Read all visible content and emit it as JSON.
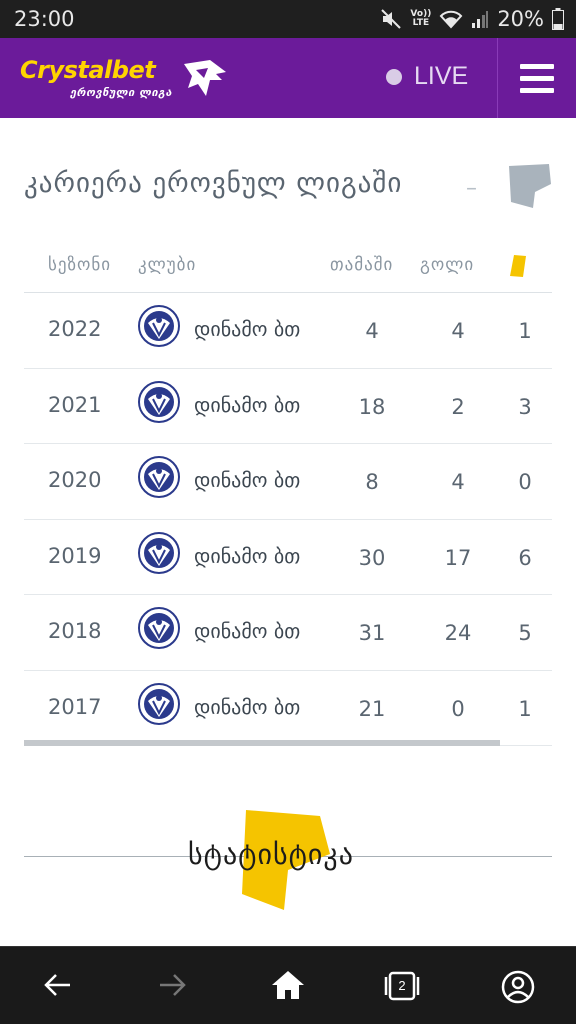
{
  "status_bar": {
    "time": "23:00",
    "volte_top": "Vo))",
    "volte_bottom": "LTE",
    "battery": "20%"
  },
  "header": {
    "logo_text": "Crystalbet",
    "logo_sub": "ეროვნული ლიგა",
    "live_label": "LIVE",
    "accent_color": "#6b1b9a",
    "logo_color": "#ffd400"
  },
  "career": {
    "title": "კარიერა ეროვნულ ლიგაში",
    "columns": {
      "season": "სეზონი",
      "club": "კლუბი",
      "games": "თამაში",
      "goals": "გოლი"
    },
    "rows": [
      {
        "season": "2022",
        "club": "დინამო ბთ",
        "games": "4",
        "goals": "4",
        "cards": "1"
      },
      {
        "season": "2021",
        "club": "დინამო ბთ",
        "games": "18",
        "goals": "2",
        "cards": "3"
      },
      {
        "season": "2020",
        "club": "დინამო ბთ",
        "games": "8",
        "goals": "4",
        "cards": "0"
      },
      {
        "season": "2019",
        "club": "დინამო ბთ",
        "games": "30",
        "goals": "17",
        "cards": "6"
      },
      {
        "season": "2018",
        "club": "დინამო ბთ",
        "games": "31",
        "goals": "24",
        "cards": "5"
      },
      {
        "season": "2017",
        "club": "დინამო ბთ",
        "games": "21",
        "goals": "0",
        "cards": "1"
      }
    ]
  },
  "stats": {
    "label": "სტატისტიკა",
    "accent_color": "#f5c400"
  },
  "bottom_nav": {
    "tabs_count": "2"
  }
}
